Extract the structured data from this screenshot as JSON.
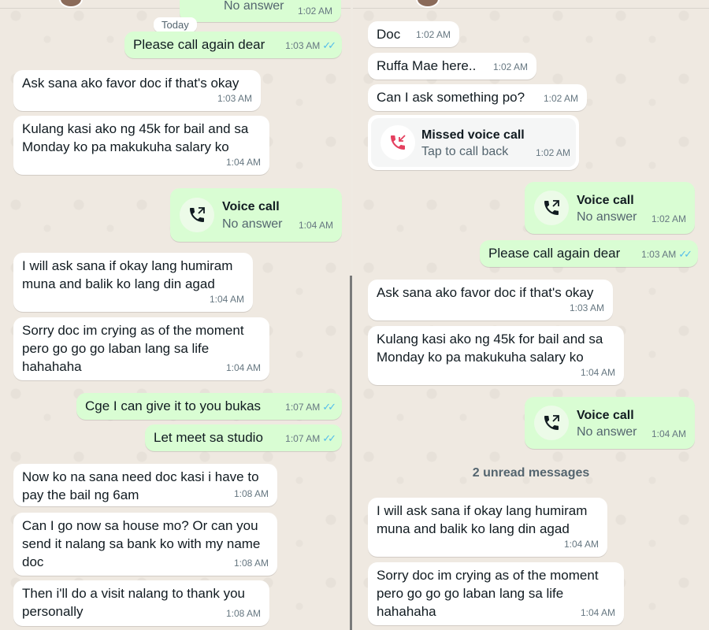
{
  "left": {
    "partial_top": {
      "text": "No answer",
      "time": "1:02 AM"
    },
    "day_label": "Today",
    "messages": [
      {
        "text": "Please call again dear",
        "time": "1:03 AM"
      },
      {
        "text": "Ask sana ako favor doc if that's okay",
        "time": "1:03 AM"
      },
      {
        "text": "Kulang kasi ako ng 45k for bail and sa\nMonday ko pa makukuha salary ko",
        "time": "1:04 AM"
      },
      {
        "title": "Voice call",
        "subtitle": "No answer",
        "time": "1:04 AM"
      },
      {
        "text": "I will ask sana if okay lang humiram\nmuna and balik ko lang din agad",
        "time": "1:04 AM"
      },
      {
        "text": "Sorry doc im crying as of the moment\npero go go go laban lang sa life\nhahahaha",
        "time": "1:04 AM"
      },
      {
        "text": "Cge I can give it to you bukas",
        "time": "1:07 AM"
      },
      {
        "text": "Let meet sa studio",
        "time": "1:07 AM"
      },
      {
        "text": "Now ko na sana need doc kasi i have to\npay the bail ng 6am",
        "time": "1:08 AM"
      },
      {
        "text": "Can I go now sa house mo? Or can you\nsend it nalang sa bank ko with my name\ndoc",
        "time": "1:08 AM"
      },
      {
        "text": "Then i'll do a visit nalang to thank you\npersonally",
        "time": "1:08 AM"
      }
    ]
  },
  "right": {
    "messages": [
      {
        "text": "Doc",
        "time": "1:02 AM"
      },
      {
        "text": "Ruffa Mae here..",
        "time": "1:02 AM"
      },
      {
        "text": "Can I ask something po?",
        "time": "1:02 AM"
      },
      {
        "title": "Missed voice call",
        "subtitle": "Tap to call back",
        "time": "1:02 AM"
      },
      {
        "title": "Voice call",
        "subtitle": "No answer",
        "time": "1:02 AM"
      },
      {
        "text": "Please call again dear",
        "time": "1:03 AM"
      },
      {
        "text": "Ask sana ako favor doc if that's okay",
        "time": "1:03 AM"
      },
      {
        "text": "Kulang kasi ako ng 45k for bail and sa\nMonday ko pa makukuha salary ko",
        "time": "1:04 AM"
      },
      {
        "title": "Voice call",
        "subtitle": "No answer",
        "time": "1:04 AM"
      },
      {
        "text": "I will ask sana if okay lang humiram\nmuna and balik ko lang din agad",
        "time": "1:04 AM"
      },
      {
        "text": "Sorry doc im crying as of the moment\npero go go go laban lang sa life\nhahahaha",
        "time": "1:04 AM"
      }
    ],
    "unread_label": "2 unread messages"
  },
  "colors": {
    "outgoing": "#d9fdd3",
    "incoming": "#ffffff",
    "read_ticks": "#53bdeb",
    "missed_call": "#e4405f"
  },
  "icons": {
    "call": "phone-outgoing-icon",
    "missed": "phone-missed-icon",
    "read": "double-check-icon"
  }
}
